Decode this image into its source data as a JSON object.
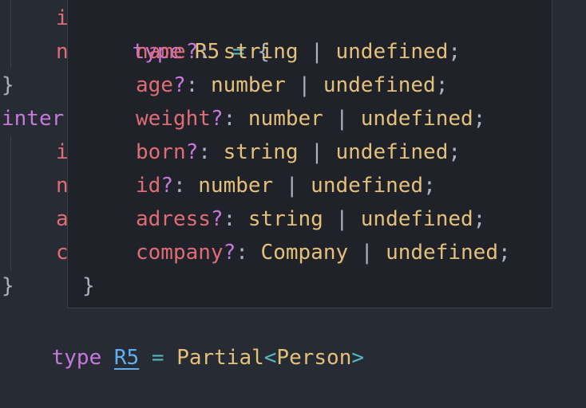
{
  "editor": {
    "behind_lines": [
      {
        "text": "i",
        "color": "#e06c75"
      },
      {
        "text": "n",
        "color": "#e06c75"
      },
      {
        "text": "}",
        "color": "#abb2bf"
      },
      {
        "text": "inter",
        "color": "#c678dd"
      },
      {
        "text": "i",
        "color": "#e06c75"
      },
      {
        "text": "n",
        "color": "#e06c75"
      },
      {
        "text": "a",
        "color": "#e06c75"
      },
      {
        "text": "c",
        "color": "#e06c75"
      },
      {
        "text": "}",
        "color": "#abb2bf"
      }
    ],
    "last_line": {
      "keyword": "type",
      "name": "R5",
      "op": "=",
      "generic": "Partial",
      "lt": "<",
      "arg": "Person",
      "gt": ">"
    }
  },
  "tooltip": {
    "header": {
      "keyword": "type",
      "name": "R5",
      "op": "=",
      "brace": "{"
    },
    "fields": [
      {
        "name": "name",
        "opt": "?",
        "colon": ":",
        "type": "string",
        "pipe": "|",
        "alt": "undefined",
        "semi": ";"
      },
      {
        "name": "age",
        "opt": "?",
        "colon": ":",
        "type": "number",
        "pipe": "|",
        "alt": "undefined",
        "semi": ";"
      },
      {
        "name": "weight",
        "opt": "?",
        "colon": ":",
        "type": "number",
        "pipe": "|",
        "alt": "undefined",
        "semi": ";"
      },
      {
        "name": "born",
        "opt": "?",
        "colon": ":",
        "type": "string",
        "pipe": "|",
        "alt": "undefined",
        "semi": ";"
      },
      {
        "name": "id",
        "opt": "?",
        "colon": ":",
        "type": "number",
        "pipe": "|",
        "alt": "undefined",
        "semi": ";"
      },
      {
        "name": "adress",
        "opt": "?",
        "colon": ":",
        "type": "string",
        "pipe": "|",
        "alt": "undefined",
        "semi": ";"
      },
      {
        "name": "company",
        "opt": "?",
        "colon": ":",
        "type": "Company",
        "pipe": "|",
        "alt": "undefined",
        "semi": ";"
      }
    ],
    "footer": "}"
  }
}
